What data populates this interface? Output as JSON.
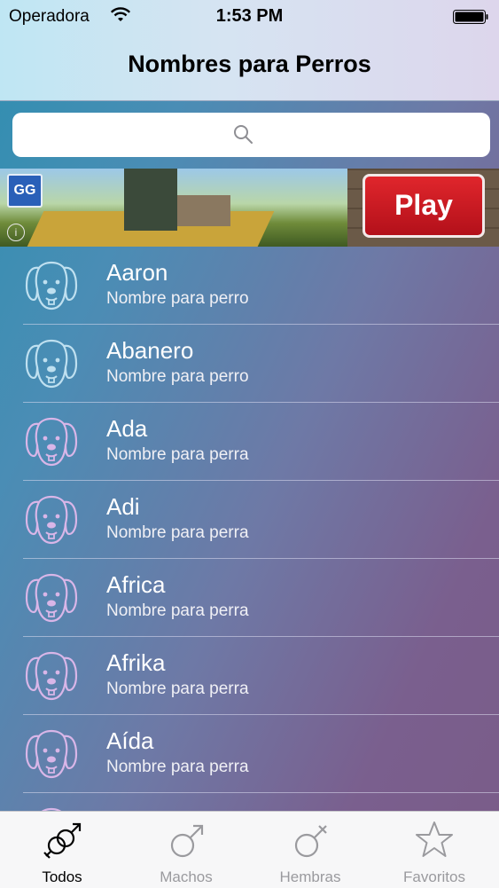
{
  "status": {
    "carrier": "Operadora",
    "time": "1:53 PM"
  },
  "nav": {
    "title": "Nombres para Perros"
  },
  "search": {
    "placeholder": ""
  },
  "ad": {
    "logo": "GG",
    "info": "i",
    "cta": "Play"
  },
  "list": [
    {
      "name": "Aaron",
      "subtitle": "Nombre para perro",
      "gender": "male"
    },
    {
      "name": "Abanero",
      "subtitle": "Nombre para perro",
      "gender": "male"
    },
    {
      "name": "Ada",
      "subtitle": "Nombre para perra",
      "gender": "female"
    },
    {
      "name": "Adi",
      "subtitle": "Nombre para perra",
      "gender": "female"
    },
    {
      "name": "Africa",
      "subtitle": "Nombre para perra",
      "gender": "female"
    },
    {
      "name": "Afrika",
      "subtitle": "Nombre para perra",
      "gender": "female"
    },
    {
      "name": "Aída",
      "subtitle": "Nombre para perra",
      "gender": "female"
    }
  ],
  "colors": {
    "male_icon": "#bfe0f0",
    "female_icon": "#d9b6e8",
    "accent": "#000000"
  },
  "tabs": [
    {
      "label": "Todos",
      "icon": "male-female-icon",
      "active": true
    },
    {
      "label": "Machos",
      "icon": "male-icon",
      "active": false
    },
    {
      "label": "Hembras",
      "icon": "female-icon",
      "active": false
    },
    {
      "label": "Favoritos",
      "icon": "star-icon",
      "active": false
    }
  ]
}
